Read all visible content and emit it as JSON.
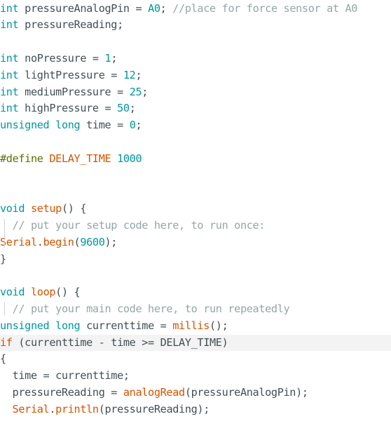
{
  "editor": {
    "language": "Arduino C++",
    "colors": {
      "code": "#434f54",
      "type_keyword": "#00979c",
      "number": "#00979c",
      "function": "#d35400",
      "preprocessor": "#5e6d03",
      "comment": "#95a5a6",
      "current_line_highlight": "#f3f3f3"
    },
    "lines": [
      [
        {
          "t": "int",
          "k": "type"
        },
        {
          "t": " pressureAnalogPin = ",
          "k": "code"
        },
        {
          "t": "A0",
          "k": "type"
        },
        {
          "t": "; ",
          "k": "code"
        },
        {
          "t": "//place for force sensor at A0",
          "k": "comment"
        }
      ],
      [
        {
          "t": "int",
          "k": "type"
        },
        {
          "t": " pressureReading;",
          "k": "code"
        }
      ],
      [],
      [
        {
          "t": "int",
          "k": "type"
        },
        {
          "t": " noPressure = ",
          "k": "code"
        },
        {
          "t": "1",
          "k": "num"
        },
        {
          "t": ";",
          "k": "code"
        }
      ],
      [
        {
          "t": "int",
          "k": "type"
        },
        {
          "t": " lightPressure = ",
          "k": "code"
        },
        {
          "t": "12",
          "k": "num"
        },
        {
          "t": ";",
          "k": "code"
        }
      ],
      [
        {
          "t": "int",
          "k": "type"
        },
        {
          "t": " mediumPressure = ",
          "k": "code"
        },
        {
          "t": "25",
          "k": "num"
        },
        {
          "t": ";",
          "k": "code"
        }
      ],
      [
        {
          "t": "int",
          "k": "type"
        },
        {
          "t": " highPressure = ",
          "k": "code"
        },
        {
          "t": "50",
          "k": "num"
        },
        {
          "t": ";",
          "k": "code"
        }
      ],
      [
        {
          "t": "unsigned",
          "k": "type"
        },
        {
          "t": " ",
          "k": "code"
        },
        {
          "t": "long",
          "k": "type"
        },
        {
          "t": " time = ",
          "k": "code"
        },
        {
          "t": "0",
          "k": "num"
        },
        {
          "t": ";",
          "k": "code"
        }
      ],
      [],
      [
        {
          "t": "#define",
          "k": "macro"
        },
        {
          "t": " ",
          "k": "code"
        },
        {
          "t": "DELAY_TIME",
          "k": "func"
        },
        {
          "t": " ",
          "k": "code"
        },
        {
          "t": "1000",
          "k": "num"
        }
      ],
      [],
      [],
      [
        {
          "t": "void",
          "k": "type"
        },
        {
          "t": " ",
          "k": "code"
        },
        {
          "t": "setup",
          "k": "func"
        },
        {
          "t": "() {",
          "k": "code"
        }
      ],
      [
        {
          "t": "  ",
          "k": "code"
        },
        {
          "t": "// put your setup code here, to run once:",
          "k": "comment"
        }
      ],
      [
        {
          "t": "Serial",
          "k": "func"
        },
        {
          "t": ".",
          "k": "code"
        },
        {
          "t": "begin",
          "k": "func"
        },
        {
          "t": "(",
          "k": "code"
        },
        {
          "t": "9600",
          "k": "num"
        },
        {
          "t": ");",
          "k": "code"
        }
      ],
      [
        {
          "t": "}",
          "k": "code"
        }
      ],
      [],
      [
        {
          "t": "void",
          "k": "type"
        },
        {
          "t": " ",
          "k": "code"
        },
        {
          "t": "loop",
          "k": "func"
        },
        {
          "t": "() {",
          "k": "code"
        }
      ],
      [
        {
          "t": "  ",
          "k": "code"
        },
        {
          "t": "// put your main code here, to run repeatedly",
          "k": "comment"
        }
      ],
      [
        {
          "t": "unsigned",
          "k": "type"
        },
        {
          "t": " ",
          "k": "code"
        },
        {
          "t": "long",
          "k": "type"
        },
        {
          "t": " currenttime = ",
          "k": "code"
        },
        {
          "t": "millis",
          "k": "func"
        },
        {
          "t": "();",
          "k": "code"
        }
      ],
      [
        {
          "t": "if",
          "k": "func"
        },
        {
          "t": " (currenttime - time >= DELAY_TIME)",
          "k": "code"
        }
      ],
      [
        {
          "t": "{",
          "k": "code"
        }
      ],
      [
        {
          "t": "  time = currenttime;",
          "k": "code"
        }
      ],
      [
        {
          "t": "  pressureReading = ",
          "k": "code"
        },
        {
          "t": "analogRead",
          "k": "func"
        },
        {
          "t": "(pressureAnalogPin);",
          "k": "code"
        }
      ],
      [
        {
          "t": "  ",
          "k": "code"
        },
        {
          "t": "Serial",
          "k": "func"
        },
        {
          "t": ".",
          "k": "code"
        },
        {
          "t": "println",
          "k": "func"
        },
        {
          "t": "(pressureReading);",
          "k": "code"
        }
      ]
    ]
  }
}
